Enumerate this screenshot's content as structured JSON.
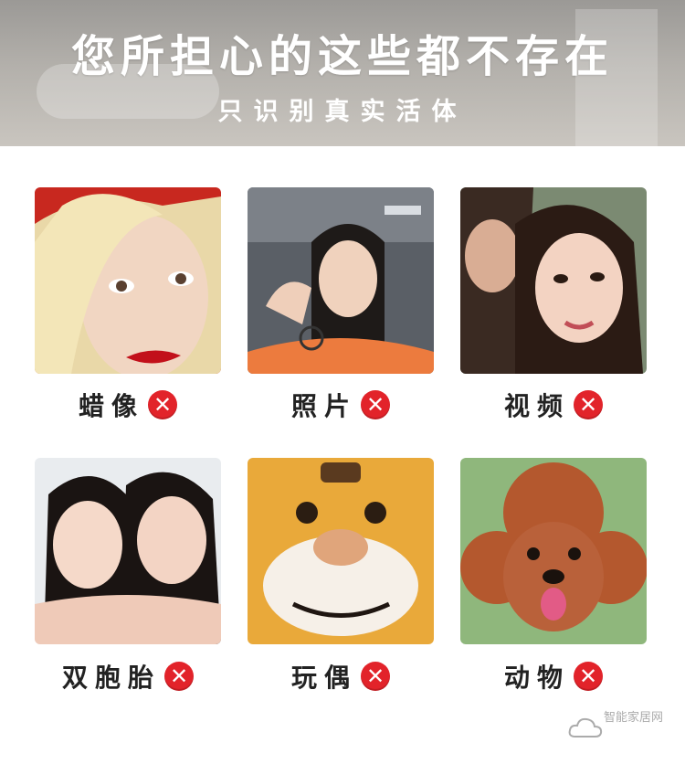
{
  "banner": {
    "title": "您所担心的这些都不存在",
    "subtitle": "只识别真实活体"
  },
  "items": [
    {
      "label": "蜡像",
      "image": "wax-figure-woman-photo",
      "status_icon": "x-icon"
    },
    {
      "label": "照片",
      "image": "photo-woman-in-car",
      "status_icon": "x-icon"
    },
    {
      "label": "视频",
      "image": "video-selfie-two-women",
      "status_icon": "x-icon"
    },
    {
      "label": "双胞胎",
      "image": "twins-girls-photo",
      "status_icon": "x-icon"
    },
    {
      "label": "玩偶",
      "image": "tiger-plush-toy-photo",
      "status_icon": "x-icon"
    },
    {
      "label": "动物",
      "image": "poodle-dog-photo",
      "status_icon": "x-icon"
    }
  ],
  "watermark": {
    "text": "智能家居网"
  },
  "colors": {
    "x_red": "#e2232a",
    "banner_gray": "#b3b0ab"
  }
}
